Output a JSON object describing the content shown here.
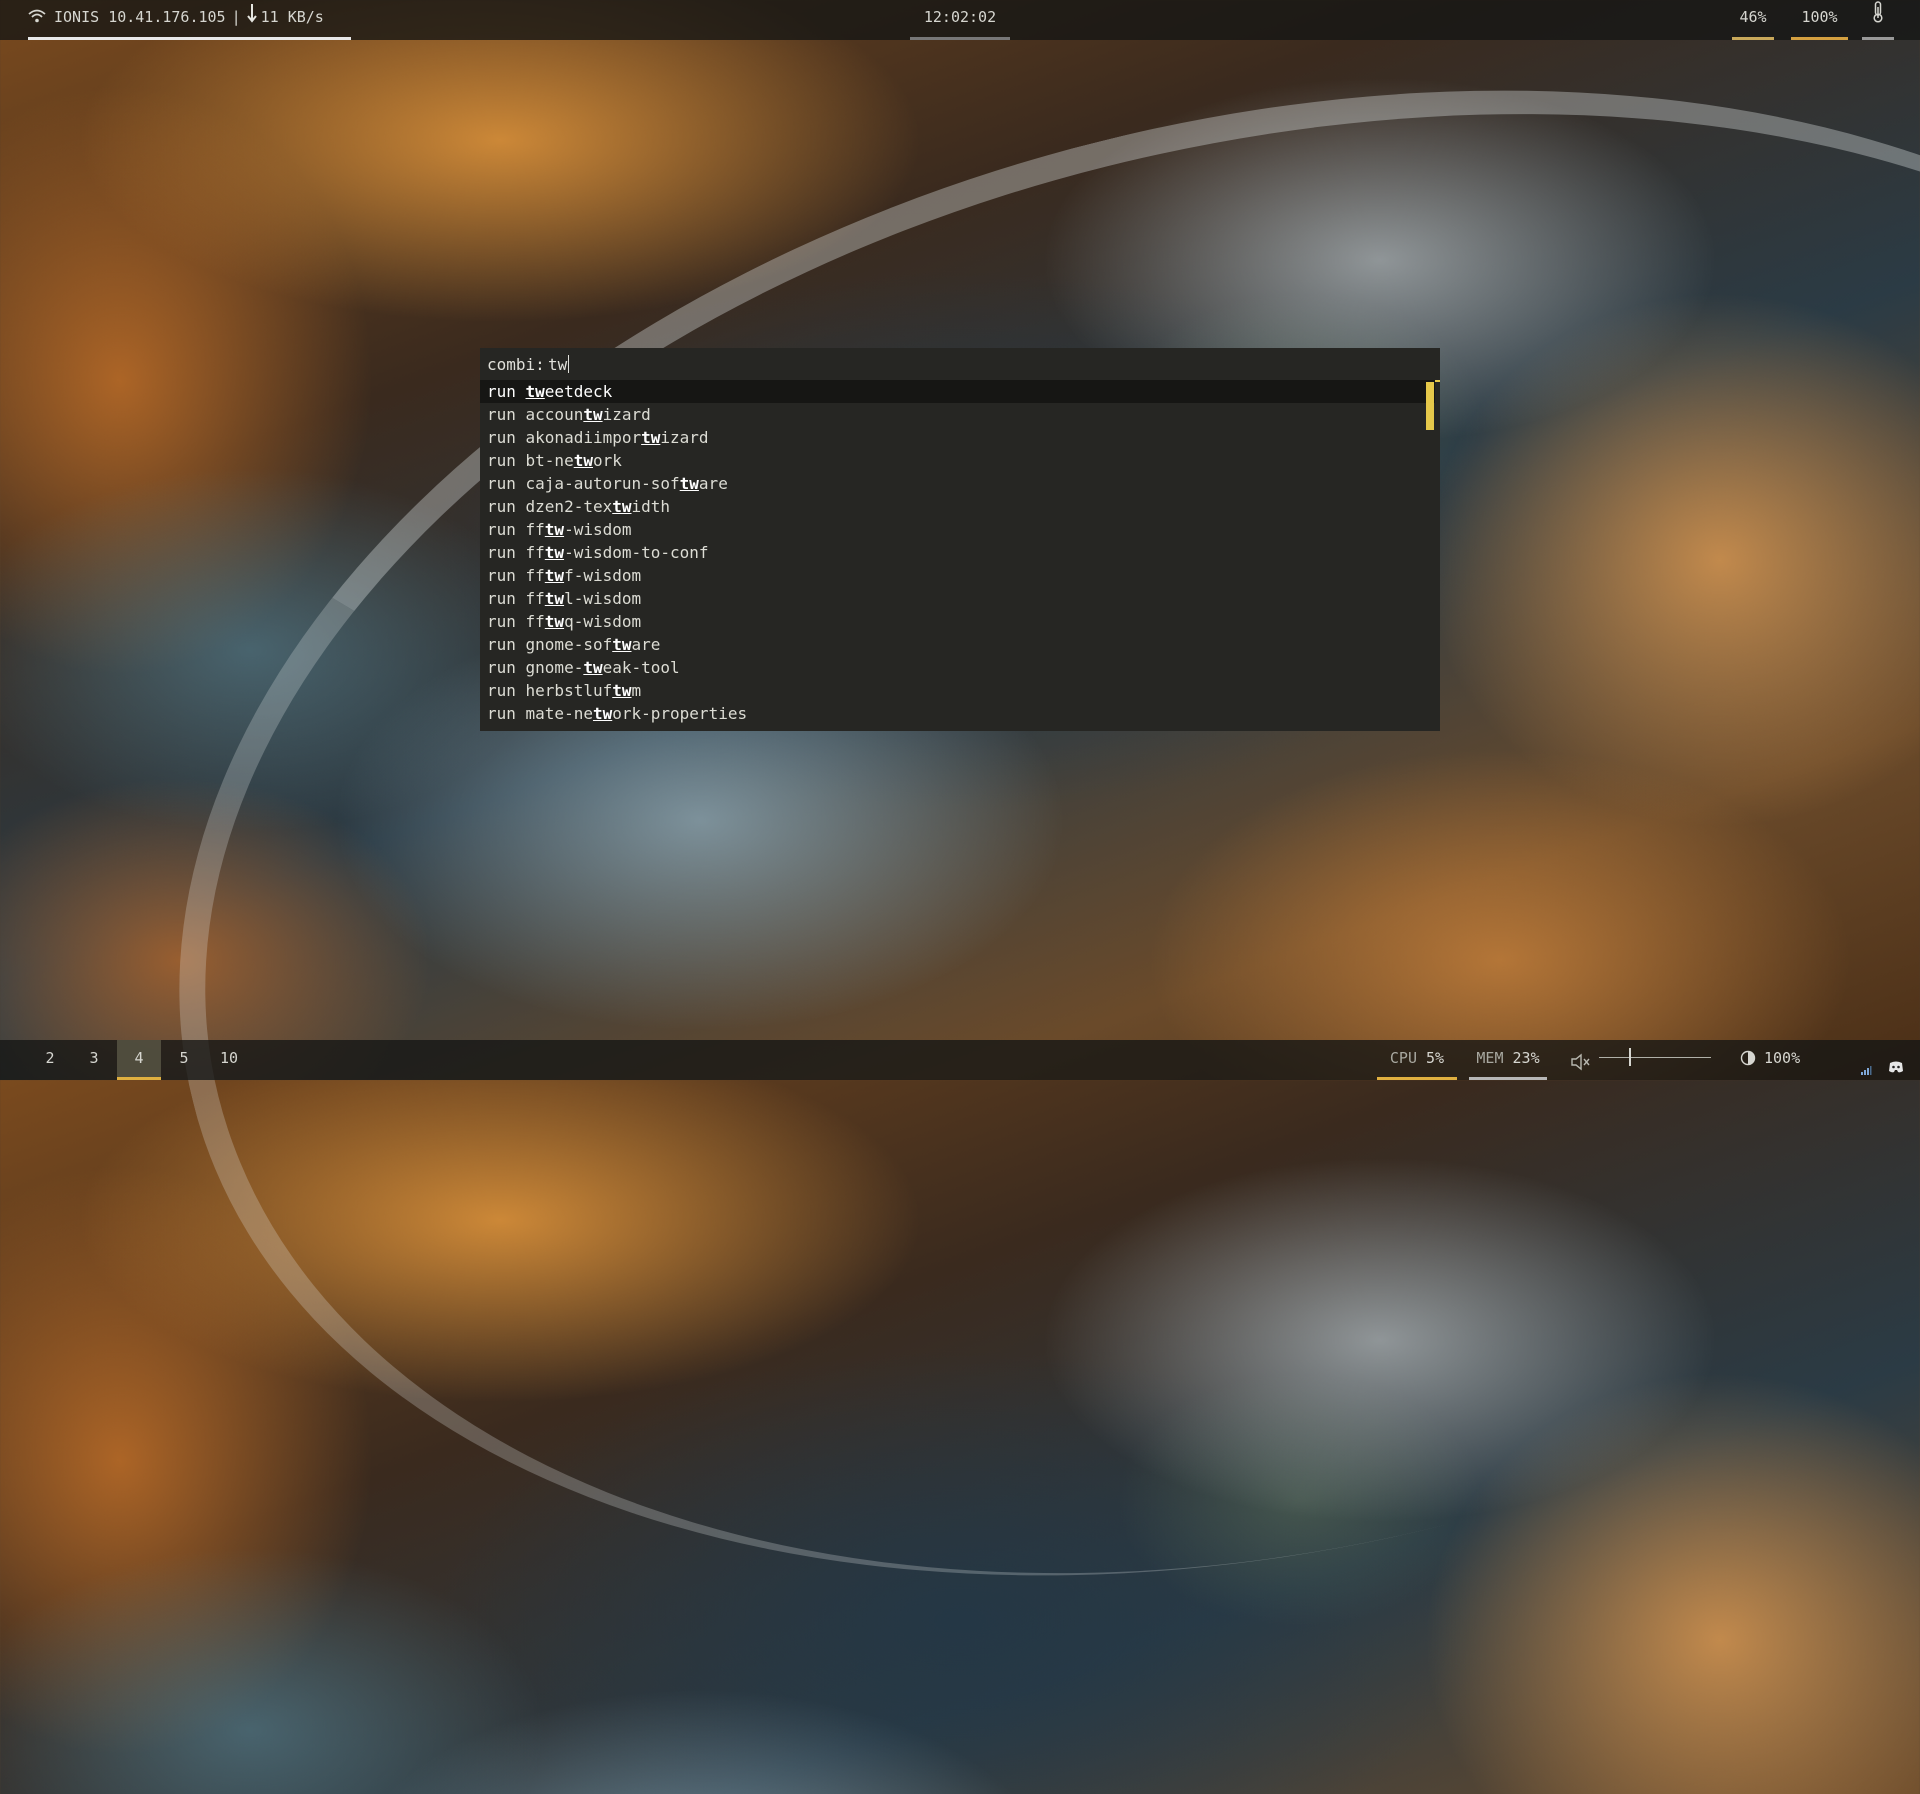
{
  "top_bar": {
    "network_name": "IONIS",
    "ip": "10.41.176.105",
    "separator": "|",
    "download_speed": "11 KB/s",
    "clock": "12:02:02",
    "cpu_or_brightness_pct": "46%",
    "battery_pct": "100%",
    "icons": [
      "wifi-icon",
      "download-arrow-icon",
      "thermometer-icon"
    ]
  },
  "launcher": {
    "mode_label": "combi:",
    "query": "tw",
    "results": [
      {
        "pre": "run ",
        "before": "",
        "match": "tw",
        "after": "eetdeck"
      },
      {
        "pre": "run ",
        "before": "accoun",
        "match": "tw",
        "after": "izard"
      },
      {
        "pre": "run ",
        "before": "akonadiimpor",
        "match": "tw",
        "after": "izard"
      },
      {
        "pre": "run ",
        "before": "bt-ne",
        "match": "tw",
        "after": "ork"
      },
      {
        "pre": "run ",
        "before": "caja-autorun-sof",
        "match": "tw",
        "after": "are"
      },
      {
        "pre": "run ",
        "before": "dzen2-tex",
        "match": "tw",
        "after": "idth"
      },
      {
        "pre": "run ",
        "before": "ff",
        "match": "tw",
        "after": "-wisdom"
      },
      {
        "pre": "run ",
        "before": "ff",
        "match": "tw",
        "after": "-wisdom-to-conf"
      },
      {
        "pre": "run ",
        "before": "ff",
        "match": "tw",
        "after": "f-wisdom"
      },
      {
        "pre": "run ",
        "before": "ff",
        "match": "tw",
        "after": "l-wisdom"
      },
      {
        "pre": "run ",
        "before": "ff",
        "match": "tw",
        "after": "q-wisdom"
      },
      {
        "pre": "run ",
        "before": "gnome-sof",
        "match": "tw",
        "after": "are"
      },
      {
        "pre": "run ",
        "before": "gnome-",
        "match": "tw",
        "after": "eak-tool"
      },
      {
        "pre": "run ",
        "before": "herbstluf",
        "match": "tw",
        "after": "m"
      },
      {
        "pre": "run ",
        "before": "mate-ne",
        "match": "tw",
        "after": "ork-properties"
      }
    ],
    "selected_index": 0
  },
  "bottom_bar": {
    "tags": [
      "2",
      "3",
      "4",
      "5",
      "10"
    ],
    "active_tag": "4",
    "cpu_label": "CPU",
    "cpu_value": "5%",
    "mem_label": "MEM",
    "mem_value": "23%",
    "volume_level": 0.27,
    "brightness_value": "100%",
    "icons": [
      "volume-muted-icon",
      "brightness-icon",
      "network-signal-icon",
      "discord-icon"
    ]
  },
  "colors": {
    "accent": "#e6c84a",
    "bar_background": "#141614",
    "launcher_background": "#262623"
  }
}
